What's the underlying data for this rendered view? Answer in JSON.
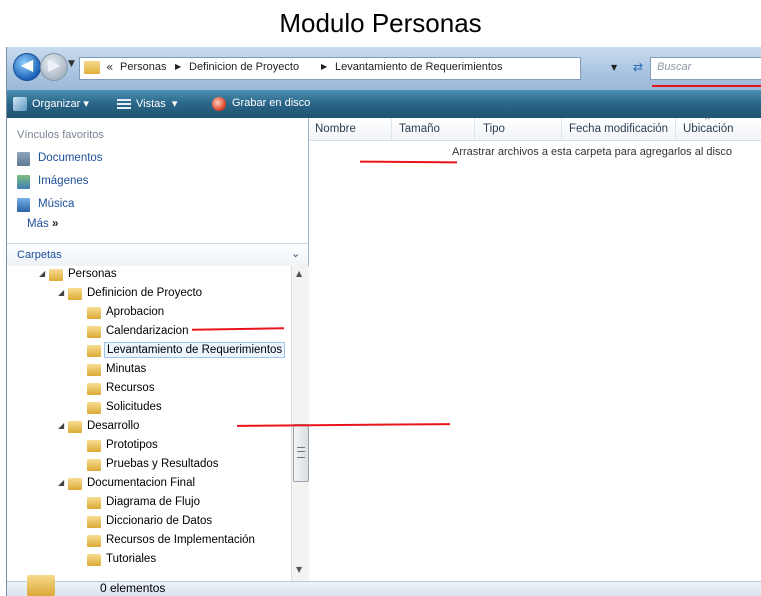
{
  "title": "Modulo Personas",
  "address": {
    "overflow_chevron": "«",
    "crumbs": [
      "Personas",
      "Definicion de Proyecto",
      "Levantamiento de Requerimientos"
    ],
    "search_placeholder": "Buscar"
  },
  "toolbar": {
    "organize": "Organizar",
    "views": "Vistas",
    "burn": "Grabar en disco"
  },
  "favorites": {
    "title": "Vínculos favoritos",
    "items": [
      "Documentos",
      "Imágenes",
      "Música"
    ],
    "more": "Más",
    "more_glyph": "»"
  },
  "folders": {
    "title": "Carpetas",
    "tree": [
      "Personas",
      "Definicion de Proyecto",
      "Aprobacion",
      "Calendarizacion",
      "Levantamiento de Requerimientos",
      "Minutas",
      "Recursos",
      "Solicitudes",
      "Desarrollo",
      "Prototipos",
      "Pruebas y Resultados",
      "Documentacion Final",
      "Diagrama de Flujo",
      "Diccionario de Datos",
      "Recursos de Implementación",
      "Tutoriales"
    ],
    "selected": "Levantamiento de Requerimientos"
  },
  "columns": [
    "Nombre",
    "Tamaño",
    "Tipo",
    "Fecha modificación",
    "Ubicación"
  ],
  "empty_message": "Arrastrar archivos a esta carpeta para agregarlos al disco",
  "status": {
    "count": "0 elementos"
  },
  "colors": {
    "annotation": "#e8141b",
    "toolbar": "#2a6587",
    "link": "#1b4f9a"
  }
}
